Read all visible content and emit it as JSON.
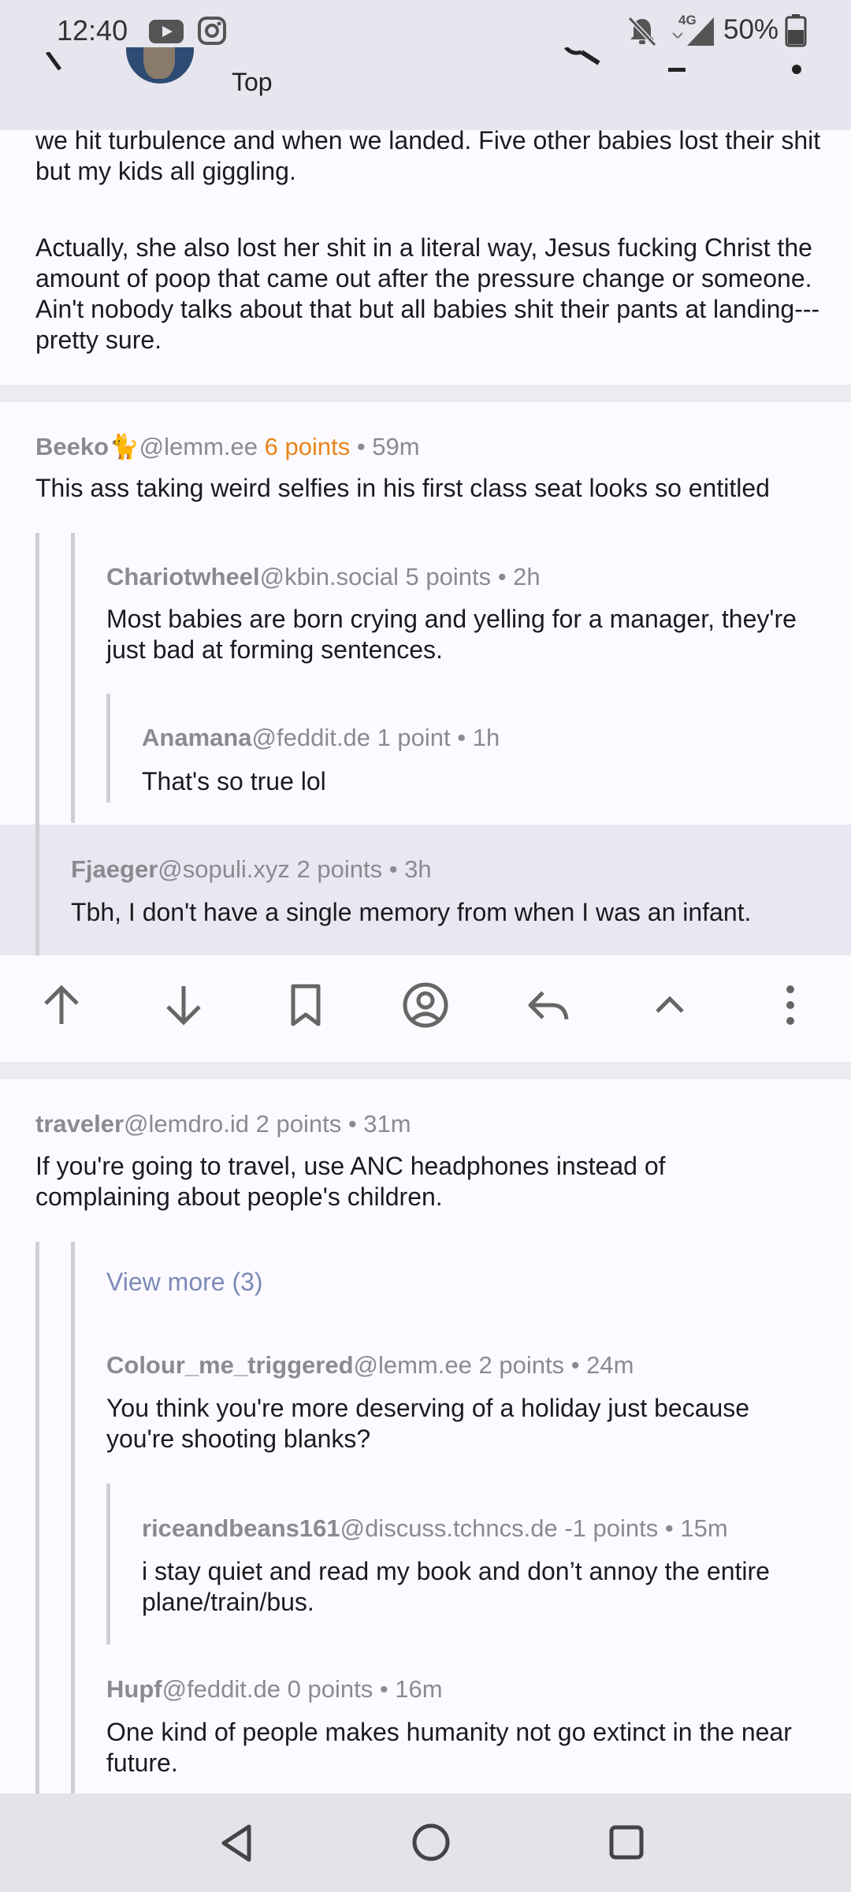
{
  "status_bar": {
    "time": "12:40",
    "network": "4G",
    "battery": "50%"
  },
  "app_bar": {
    "sort_label": "Top"
  },
  "post_tail": {
    "paragraph1": "Japan because of a family tragedy and she freaking got excited when we hit turbulence and when we landed. Five other babies lost their shit but my kids all giggling.",
    "paragraph2": "Actually, she also lost her shit in a literal way, Jesus fucking Christ the amount of poop that came out after the pressure change or someone. Ain't nobody talks about that but all babies shit their pants at landing--- pretty sure."
  },
  "comments": [
    {
      "user": "Beeko🐈",
      "instance": "@lemm.ee",
      "points": "6 points",
      "time": "• 59m",
      "text": "This ass taking weird selfies in his first class seat looks so entitled"
    },
    {
      "user": "Chariotwheel",
      "instance": "@kbin.social",
      "points": "5 points",
      "time": "• 2h",
      "text": "Most babies are born crying and yelling for a manager, they're just bad at forming sentences."
    },
    {
      "user": "Anamana",
      "instance": "@feddit.de",
      "points": "1 point",
      "time": "• 1h",
      "text": "That's so true lol"
    },
    {
      "user": "Fjaeger",
      "instance": "@sopuli.xyz",
      "points": "2 points",
      "time": "• 3h",
      "text": "Tbh, I don't have a single memory from when I was an infant."
    },
    {
      "user": "traveler",
      "instance": "@lemdro.id",
      "points": "2 points",
      "time": "• 31m",
      "text": "If you're going to travel, use ANC headphones instead of complaining about people's children."
    },
    {
      "user": "Colour_me_triggered",
      "instance": "@lemm.ee",
      "points": "2 points",
      "time": "• 24m",
      "text": "You think you're more deserving of a holiday just because you're shooting blanks?"
    },
    {
      "user": "riceandbeans161",
      "instance": "@discuss.tchncs.de",
      "points": "-1 points",
      "time": "• 15m",
      "text": "i stay quiet and read my book and don’t annoy the entire plane/train/bus."
    },
    {
      "user": "Hupf",
      "instance": "@feddit.de",
      "points": "0 points",
      "time": "• 16m",
      "text": "One kind of people makes humanity not go extinct in the near future."
    }
  ],
  "view_more": "View more (3)",
  "colors": {
    "accent_points": "#E8851B",
    "link": "#7B8AB8",
    "highlight_row": "#E9E8F2"
  }
}
